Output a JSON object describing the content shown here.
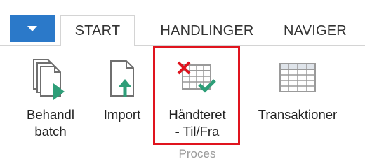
{
  "tabs": {
    "start": "START",
    "handlinger": "HANDLINGER",
    "navigate": "NAVIGER"
  },
  "buttons": {
    "behandl": {
      "line1": "Behandl",
      "line2": "batch",
      "icon": "batch-documents-icon"
    },
    "import": {
      "line1": "Import",
      "icon": "import-icon"
    },
    "handteret": {
      "line1": "Håndteret",
      "line2": "- Til/Fra",
      "icon": "handled-grid-icon"
    },
    "transaktioner": {
      "line1": "Transaktioner",
      "icon": "grid-icon"
    }
  },
  "group": {
    "label": "Proces"
  },
  "colors": {
    "app_menu": "#2b79c9",
    "highlight": "#e0141e",
    "accent_green": "#2e9e78",
    "accent_red": "#e0141e"
  }
}
